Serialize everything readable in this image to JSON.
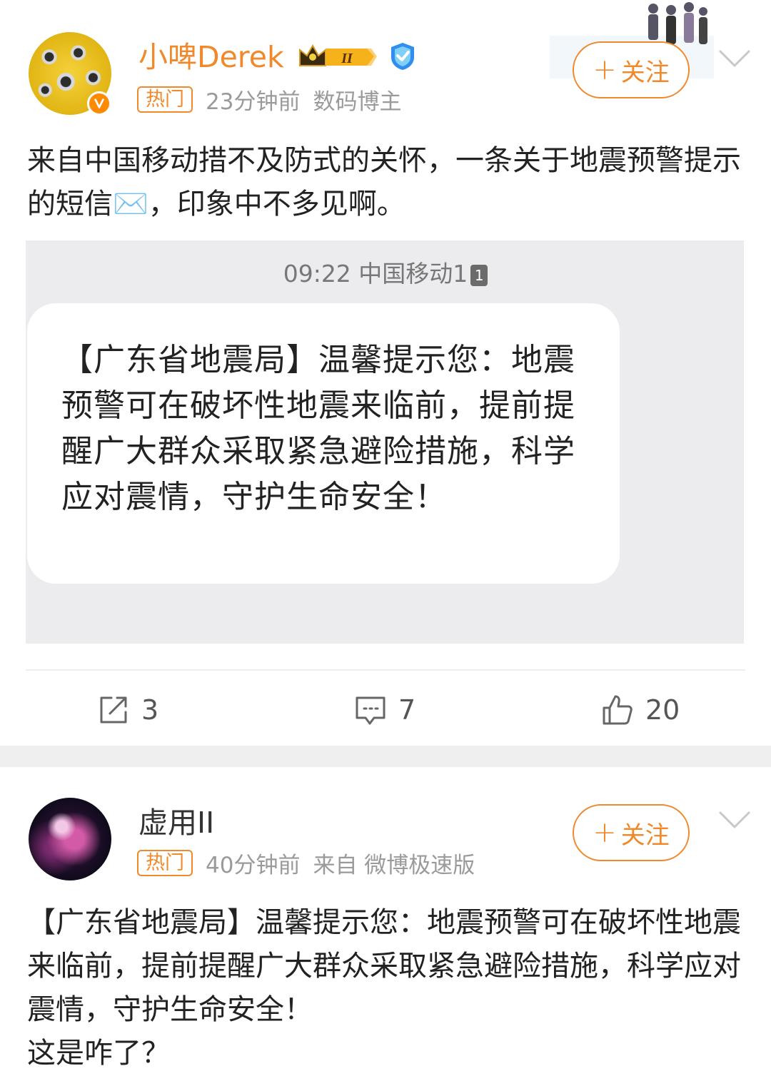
{
  "post1": {
    "username": "小啤Derek",
    "crown_level": "II",
    "hot_tag": "热门",
    "time": "23分钟前",
    "source": "数码博主",
    "follow_label": "关注",
    "text": "来自中国移动措不及防式的关怀，一条关于地震预警提示的短信✉️，印象中不多见啊。",
    "sms": {
      "time_sender": "09:22 中国移动1",
      "sim": "1",
      "message": "【广东省地震局】温馨提示您：地震预警可在破坏性地震来临前，提前提醒广大群众采取紧急避险措施，科学应对震情，守护生命安全！"
    },
    "actions": {
      "reposts": "3",
      "comments": "7",
      "likes": "20"
    }
  },
  "post2": {
    "username": "虚用II",
    "hot_tag": "热门",
    "time": "40分钟前",
    "source": "来自 微博极速版",
    "follow_label": "关注",
    "text_lines": [
      "【广东省地震局】温馨提示您：地震预警可在破坏性地震来临前，提前提醒广大群众采取紧急避险措施，科学应对震情，守护生命安全！",
      "这是咋了？"
    ]
  },
  "colors": {
    "accent": "#f0892b",
    "meta_text": "#9a9a9a",
    "separator": "#efefef"
  },
  "icons": [
    "crown-badge-icon",
    "vip-icon",
    "verified-icon",
    "chevron-down-icon",
    "repost-icon",
    "comment-icon",
    "like-icon"
  ]
}
